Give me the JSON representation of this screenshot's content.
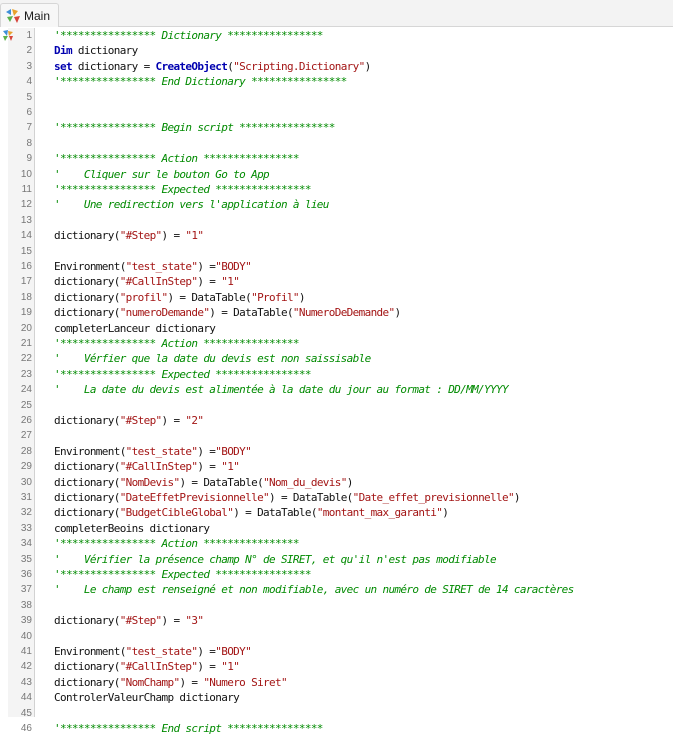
{
  "tab": {
    "label": "Main",
    "icon": "script-icon"
  },
  "lines": [
    [
      [
        "cm",
        "'**************** Dictionary ****************"
      ]
    ],
    [
      [
        "kw",
        "Dim"
      ],
      [
        "t",
        " dictionary"
      ]
    ],
    [
      [
        "kw",
        "set"
      ],
      [
        "t",
        " dictionary = "
      ],
      [
        "kw",
        "CreateObject"
      ],
      [
        "t",
        "("
      ],
      [
        "str",
        "\"Scripting.Dictionary\""
      ],
      [
        "t",
        ")"
      ]
    ],
    [
      [
        "cm",
        "'**************** End Dictionary ****************"
      ]
    ],
    [],
    [],
    [
      [
        "cm",
        "'**************** Begin script ****************"
      ]
    ],
    [],
    [
      [
        "cm",
        "'**************** Action ****************"
      ]
    ],
    [
      [
        "cm",
        "'    Cliquer sur le bouton Go to App"
      ]
    ],
    [
      [
        "cm",
        "'**************** Expected ****************"
      ]
    ],
    [
      [
        "cm",
        "'    Une redirection vers l'application à lieu"
      ]
    ],
    [],
    [
      [
        "t",
        "dictionary("
      ],
      [
        "str",
        "\"#Step\""
      ],
      [
        "t",
        ") = "
      ],
      [
        "str",
        "\"1\""
      ]
    ],
    [],
    [
      [
        "t",
        "Environment("
      ],
      [
        "str",
        "\"test_state\""
      ],
      [
        "t",
        ") ="
      ],
      [
        "str",
        "\"BODY\""
      ]
    ],
    [
      [
        "t",
        "dictionary("
      ],
      [
        "str",
        "\"#CallInStep\""
      ],
      [
        "t",
        ") = "
      ],
      [
        "str",
        "\"1\""
      ]
    ],
    [
      [
        "t",
        "dictionary("
      ],
      [
        "str",
        "\"profil\""
      ],
      [
        "t",
        ") = DataTable("
      ],
      [
        "str",
        "\"Profil\""
      ],
      [
        "t",
        ")"
      ]
    ],
    [
      [
        "t",
        "dictionary("
      ],
      [
        "str",
        "\"numeroDemande\""
      ],
      [
        "t",
        ") = DataTable("
      ],
      [
        "str",
        "\"NumeroDeDemande\""
      ],
      [
        "t",
        ")"
      ]
    ],
    [
      [
        "t",
        "completerLanceur dictionary"
      ]
    ],
    [
      [
        "cm",
        "'**************** Action ****************"
      ]
    ],
    [
      [
        "cm",
        "'    Vérfier que la date du devis est non saissisable"
      ]
    ],
    [
      [
        "cm",
        "'**************** Expected ****************"
      ]
    ],
    [
      [
        "cm",
        "'    La date du devis est alimentée à la date du jour au format : DD/MM/YYYY"
      ]
    ],
    [],
    [
      [
        "t",
        "dictionary("
      ],
      [
        "str",
        "\"#Step\""
      ],
      [
        "t",
        ") = "
      ],
      [
        "str",
        "\"2\""
      ]
    ],
    [],
    [
      [
        "t",
        "Environment("
      ],
      [
        "str",
        "\"test_state\""
      ],
      [
        "t",
        ") ="
      ],
      [
        "str",
        "\"BODY\""
      ]
    ],
    [
      [
        "t",
        "dictionary("
      ],
      [
        "str",
        "\"#CallInStep\""
      ],
      [
        "t",
        ") = "
      ],
      [
        "str",
        "\"1\""
      ]
    ],
    [
      [
        "t",
        "dictionary("
      ],
      [
        "str",
        "\"NomDevis\""
      ],
      [
        "t",
        ") = DataTable("
      ],
      [
        "str",
        "\"Nom_du_devis\""
      ],
      [
        "t",
        ")"
      ]
    ],
    [
      [
        "t",
        "dictionary("
      ],
      [
        "str",
        "\"DateEffetPrevisionnelle\""
      ],
      [
        "t",
        ") = DataTable("
      ],
      [
        "str",
        "\"Date_effet_previsionnelle\""
      ],
      [
        "t",
        ")"
      ]
    ],
    [
      [
        "t",
        "dictionary("
      ],
      [
        "str",
        "\"BudgetCibleGlobal\""
      ],
      [
        "t",
        ") = DataTable("
      ],
      [
        "str",
        "\"montant_max_garanti\""
      ],
      [
        "t",
        ")"
      ]
    ],
    [
      [
        "t",
        "completerBeoins dictionary"
      ]
    ],
    [
      [
        "cm",
        "'**************** Action ****************"
      ]
    ],
    [
      [
        "cm",
        "'    Vérifier la présence champ N° de SIRET, et qu'il n'est pas modifiable"
      ]
    ],
    [
      [
        "cm",
        "'**************** Expected ****************"
      ]
    ],
    [
      [
        "cm",
        "'    Le champ est renseigné et non modifiable, avec un numéro de SIRET de 14 caractères"
      ]
    ],
    [],
    [
      [
        "t",
        "dictionary("
      ],
      [
        "str",
        "\"#Step\""
      ],
      [
        "t",
        ") = "
      ],
      [
        "str",
        "\"3\""
      ]
    ],
    [],
    [
      [
        "t",
        "Environment("
      ],
      [
        "str",
        "\"test_state\""
      ],
      [
        "t",
        ") ="
      ],
      [
        "str",
        "\"BODY\""
      ]
    ],
    [
      [
        "t",
        "dictionary("
      ],
      [
        "str",
        "\"#CallInStep\""
      ],
      [
        "t",
        ") = "
      ],
      [
        "str",
        "\"1\""
      ]
    ],
    [
      [
        "t",
        "dictionary("
      ],
      [
        "str",
        "\"NomChamp\""
      ],
      [
        "t",
        ") = "
      ],
      [
        "str",
        "\"Numero Siret\""
      ]
    ],
    [
      [
        "t",
        "ControlerValeurChamp dictionary"
      ]
    ],
    [],
    [
      [
        "cm",
        "'**************** End script ****************"
      ]
    ]
  ]
}
